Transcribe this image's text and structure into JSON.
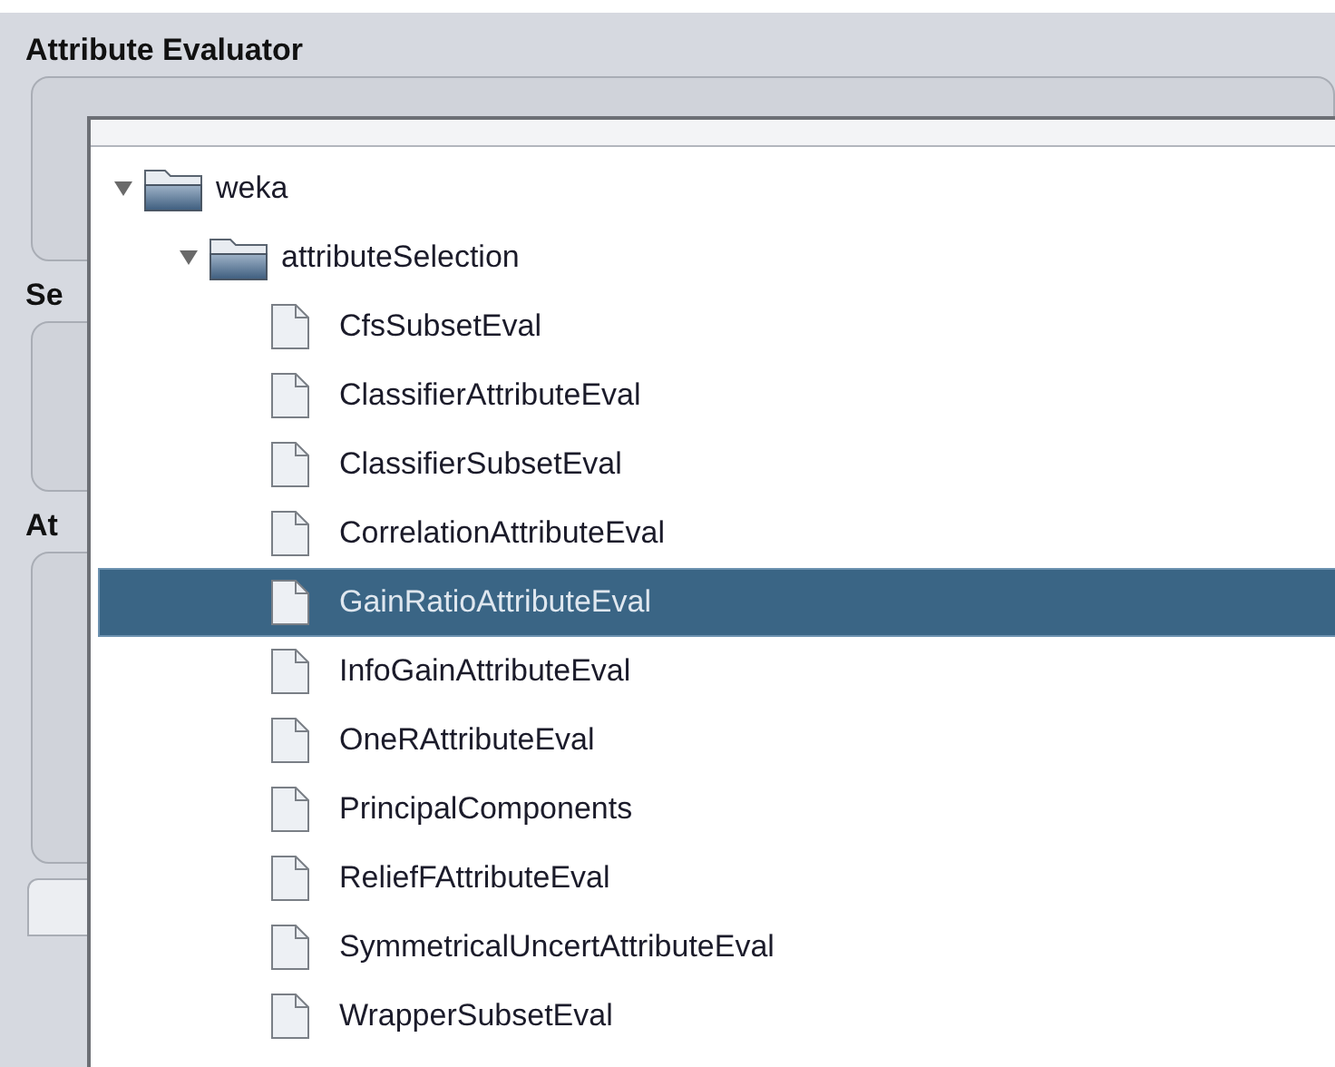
{
  "background": {
    "sections": [
      {
        "label": "Attribute Evaluator"
      },
      {
        "label": "Se"
      },
      {
        "label": "At"
      }
    ]
  },
  "tree": {
    "label": "weka",
    "expanded": true,
    "children": [
      {
        "label": "attributeSelection",
        "expanded": true,
        "children": [
          {
            "label": "CfsSubsetEval",
            "selected": false
          },
          {
            "label": "ClassifierAttributeEval",
            "selected": false
          },
          {
            "label": "ClassifierSubsetEval",
            "selected": false
          },
          {
            "label": "CorrelationAttributeEval",
            "selected": false
          },
          {
            "label": "GainRatioAttributeEval",
            "selected": true
          },
          {
            "label": "InfoGainAttributeEval",
            "selected": false
          },
          {
            "label": "OneRAttributeEval",
            "selected": false
          },
          {
            "label": "PrincipalComponents",
            "selected": false
          },
          {
            "label": "ReliefFAttributeEval",
            "selected": false
          },
          {
            "label": "SymmetricalUncertAttributeEval",
            "selected": false
          },
          {
            "label": "WrapperSubsetEval",
            "selected": false
          }
        ]
      }
    ]
  }
}
